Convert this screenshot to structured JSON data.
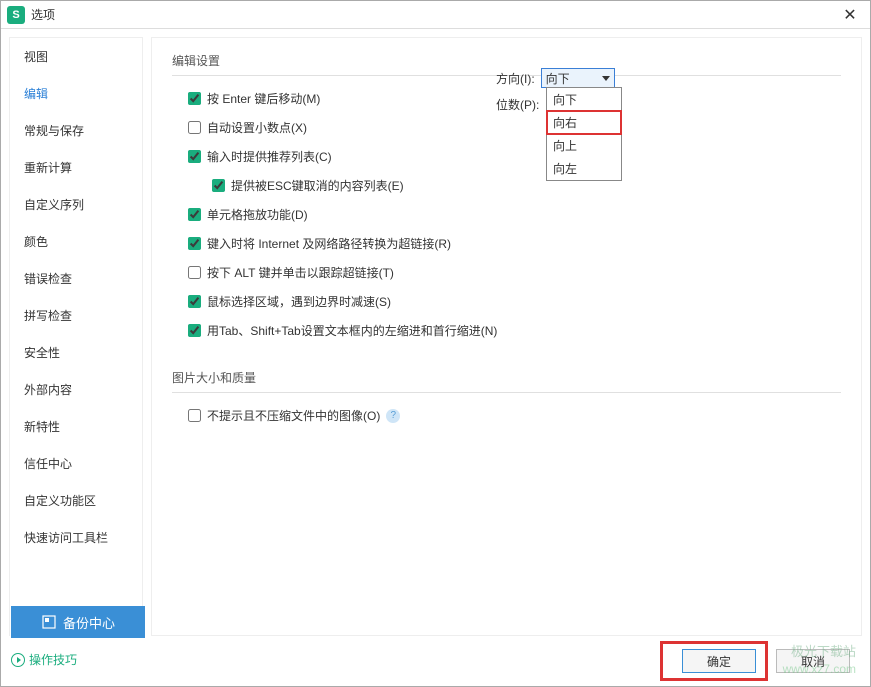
{
  "window": {
    "app_letter": "S",
    "title": "选项"
  },
  "sidebar": {
    "items": [
      "视图",
      "编辑",
      "常规与保存",
      "重新计算",
      "自定义序列",
      "颜色",
      "错误检查",
      "拼写检查",
      "安全性",
      "外部内容",
      "新特性",
      "信任中心",
      "自定义功能区",
      "快速访问工具栏"
    ],
    "active_index": 1
  },
  "sections": {
    "edit_settings": {
      "title": "编辑设置",
      "enter_move": "按 Enter 键后移动(M)",
      "direction_label": "方向(I):",
      "direction_value": "向下",
      "direction_options": [
        "向下",
        "向右",
        "向上",
        "向左"
      ],
      "auto_decimal": "自动设置小数点(X)",
      "digits_label": "位数(P):",
      "recommend_list": "输入时提供推荐列表(C)",
      "esc_cancel": "提供被ESC键取消的内容列表(E)",
      "cell_drag": "单元格拖放功能(D)",
      "hyperlink": "键入时将 Internet 及网络路径转换为超链接(R)",
      "alt_click": "按下 ALT 键并单击以跟踪超链接(T)",
      "mouse_select": "鼠标选择区域，遇到边界时减速(S)",
      "tab_indent": "用Tab、Shift+Tab设置文本框内的左缩进和首行缩进(N)"
    },
    "image_quality": {
      "title": "图片大小和质量",
      "no_compress": "不提示且不压缩文件中的图像(O)"
    }
  },
  "buttons": {
    "backup": "备份中心",
    "tips": "操作技巧",
    "ok": "确定",
    "cancel": "取消"
  },
  "watermark": {
    "line1": "极光下载站",
    "line2": "www.xz7.com"
  }
}
